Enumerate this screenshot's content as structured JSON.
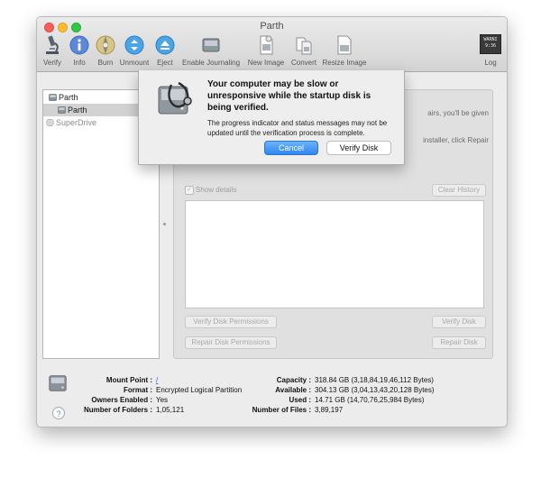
{
  "window": {
    "title": "Parth"
  },
  "colors": {
    "close": "#fc5f57",
    "minimize": "#fdbc2e",
    "zoom": "#33c748",
    "accent": "#3b8cf5"
  },
  "toolbar": {
    "verify": {
      "label": "Verify",
      "icon": "microscope-icon"
    },
    "info": {
      "label": "Info",
      "icon": "info-icon"
    },
    "burn": {
      "label": "Burn",
      "icon": "burn-disc-icon"
    },
    "unmount": {
      "label": "Unmount",
      "icon": "unmount-icon"
    },
    "eject": {
      "label": "Eject",
      "icon": "eject-icon"
    },
    "enable_journaling": {
      "label": "Enable Journaling",
      "icon": "journaling-disk-icon"
    },
    "new_image": {
      "label": "New Image",
      "icon": "new-image-icon"
    },
    "convert": {
      "label": "Convert",
      "icon": "convert-icon"
    },
    "resize_image": {
      "label": "Resize Image",
      "icon": "resize-image-icon"
    },
    "log": {
      "label": "Log",
      "icon": "log-icon",
      "badge": "WARNI 9:36"
    }
  },
  "sidebar": {
    "items": [
      {
        "label": "Parth",
        "icon": "hard-drive-icon"
      },
      {
        "label": "Parth",
        "icon": "volume-icon"
      },
      {
        "label": "SuperDrive",
        "icon": "superdrive-icon"
      }
    ]
  },
  "main": {
    "line1": "airs, you'll be given",
    "line2": "installer, click Repair",
    "show_details": "Show details",
    "clear_history": "Clear History",
    "verify_permissions": "Verify Disk Permissions",
    "verify_disk": "Verify Disk",
    "repair_permissions": "Repair Disk Permissions",
    "repair_disk": "Repair Disk"
  },
  "info": {
    "mount_point_label": "Mount Point :",
    "mount_point_value": "/",
    "format_label": "Format :",
    "format_value": "Encrypted Logical Partition",
    "owners_label": "Owners Enabled :",
    "owners_value": "Yes",
    "folders_label": "Number of Folders :",
    "folders_value": "1,05,121",
    "capacity_label": "Capacity :",
    "capacity_value": "318.84 GB (3,18,84,19,46,112 Bytes)",
    "available_label": "Available :",
    "available_value": "304.13 GB (3,04,13,43,20,128 Bytes)",
    "used_label": "Used :",
    "used_value": "14.71 GB (14,70,76,25,984 Bytes)",
    "files_label": "Number of Files :",
    "files_value": "3,89,197",
    "help": "?"
  },
  "sheet": {
    "heading": "Your computer may be slow or unresponsive while the startup disk is being verified.",
    "message": "The progress indicator and status messages may not be updated until the verification process is complete.",
    "cancel": "Cancel",
    "verify_disk": "Verify Disk",
    "icon": "disk-stethoscope-icon"
  }
}
